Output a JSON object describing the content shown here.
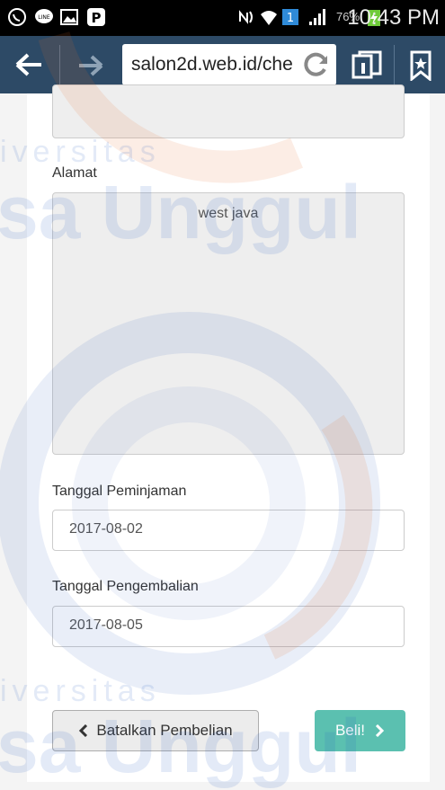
{
  "status_bar": {
    "time": "10:43 PM",
    "battery": "76%",
    "icons": [
      "whatsapp-icon",
      "line-icon",
      "gallery-icon",
      "pinterest-icon",
      "nfc-icon",
      "wifi-icon",
      "notification-count-icon",
      "signal-icon",
      "battery-charging-icon"
    ],
    "notification_count": "1"
  },
  "browser": {
    "url": "salon2d.web.id/che",
    "icons": [
      "back-arrow-icon",
      "forward-arrow-icon",
      "reload-icon",
      "tabs-icon",
      "bookmark-icon"
    ]
  },
  "form": {
    "alamat_label": "Alamat",
    "alamat_value": "west java",
    "pinjam_label": "Tanggal Peminjaman",
    "pinjam_value": "2017-08-02",
    "kembali_label": "Tanggal Pengembalian",
    "kembali_value": "2017-08-05"
  },
  "buttons": {
    "cancel_label": "Batalkan Pembelian",
    "buy_label": "Beli!"
  },
  "watermark": {
    "line1": "iversitas",
    "line2": "sa Unggul"
  },
  "colors": {
    "toolbar": "#2d4a66",
    "buy_button": "#5bc0b0",
    "watermark": "#285abe"
  }
}
